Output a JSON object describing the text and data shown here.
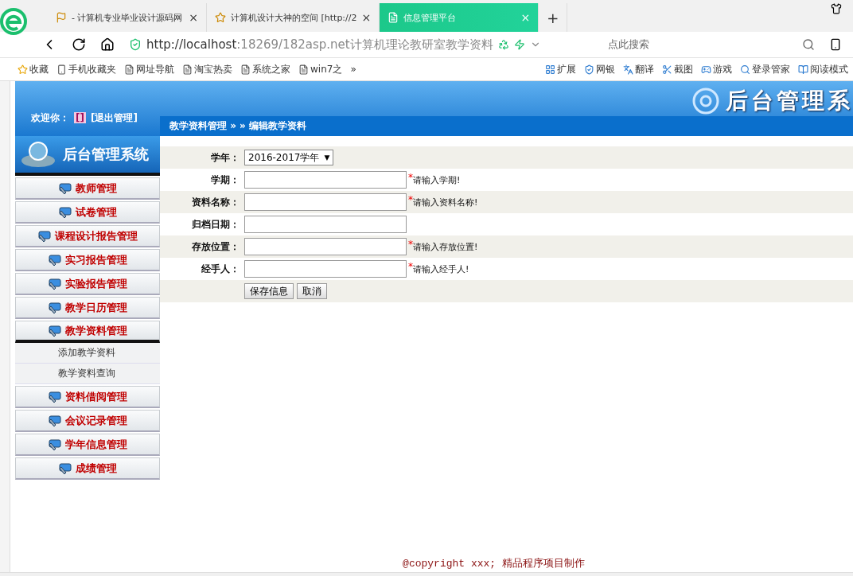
{
  "browser": {
    "tabs": [
      {
        "label": "- 计算机专业毕业设计源码网",
        "kind": "flag",
        "close": "×",
        "selected": false
      },
      {
        "label": "计算机设计大神的空间 [http://2",
        "kind": "star",
        "close": "×",
        "selected": false
      },
      {
        "label": "信息管理平台",
        "kind": "page",
        "close": "×",
        "selected": true
      }
    ],
    "new_tab": "+",
    "url_host": "http://localhost",
    "url_rest": ":18269/182asp.net计算机理论教研室教学资料",
    "search": {
      "placeholder": "点此搜索"
    },
    "bookmarks": [
      {
        "label": "收藏",
        "kind": "star"
      },
      {
        "label": "手机收藏夹",
        "kind": "phone"
      },
      {
        "label": "网址导航",
        "kind": "page"
      },
      {
        "label": "淘宝热卖",
        "kind": "page"
      },
      {
        "label": "系统之家",
        "kind": "page"
      },
      {
        "label": "win7之",
        "kind": "page"
      },
      {
        "label": "»",
        "kind": "more"
      }
    ],
    "tools": [
      {
        "label": "扩展",
        "kind": "grid"
      },
      {
        "label": "网银",
        "kind": "shield"
      },
      {
        "label": "翻译",
        "kind": "translate"
      },
      {
        "label": "截图",
        "kind": "scissors"
      },
      {
        "label": "游戏",
        "kind": "gamepad"
      },
      {
        "label": "登录管家",
        "kind": "search"
      },
      {
        "label": "阅读模式",
        "kind": "book"
      }
    ]
  },
  "header": {
    "welcome": "欢迎你：",
    "user": "[]",
    "logout": "[退出管理]",
    "banner_title": "后台管理系"
  },
  "sidebar": {
    "logo": "后台管理系统",
    "items": [
      {
        "label": "教师管理",
        "expanded": false
      },
      {
        "label": "试卷管理",
        "expanded": false
      },
      {
        "label": "课程设计报告管理",
        "expanded": false
      },
      {
        "label": "实习报告管理",
        "expanded": false
      },
      {
        "label": "实验报告管理",
        "expanded": false
      },
      {
        "label": "教学日历管理",
        "expanded": false
      },
      {
        "label": "教学资料管理",
        "expanded": true,
        "children": [
          {
            "label": "添加教学资料"
          },
          {
            "label": "教学资料查询"
          }
        ]
      },
      {
        "label": "资料借阅管理",
        "expanded": false
      },
      {
        "label": "会议记录管理",
        "expanded": false
      },
      {
        "label": "学年信息管理",
        "expanded": false
      },
      {
        "label": "成绩管理",
        "expanded": false
      }
    ]
  },
  "breadcrumb": "教学资料管理 » » 编辑教学资料",
  "form": {
    "fields": [
      {
        "label": "学年：",
        "kind": "select",
        "value": "2016-2017学年",
        "arrow": "▼"
      },
      {
        "label": "学期：",
        "kind": "input",
        "required_mark": "*",
        "hint": "请输入学期!"
      },
      {
        "label": "资料名称：",
        "kind": "input",
        "required_mark": "*",
        "hint": "请输入资料名称!"
      },
      {
        "label": "归档日期：",
        "kind": "input"
      },
      {
        "label": "存放位置：",
        "kind": "input",
        "required_mark": "*",
        "hint": "请输入存放位置!"
      },
      {
        "label": "经手人：",
        "kind": "input",
        "required_mark": "*",
        "hint": "请输入经手人!"
      }
    ],
    "buttons": [
      "保存信息",
      "取消"
    ]
  },
  "footer": "@copyright xxx; 精品程序项目制作"
}
